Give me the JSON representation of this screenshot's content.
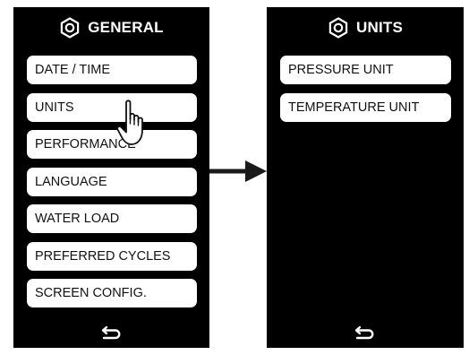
{
  "left_screen": {
    "title": "GENERAL",
    "icon": "hex-nut-settings-icon",
    "items": [
      {
        "label": "DATE / TIME"
      },
      {
        "label": "UNITS"
      },
      {
        "label": "PERFORMANCE"
      },
      {
        "label": "LANGUAGE"
      },
      {
        "label": "WATER LOAD"
      },
      {
        "label": "PREFERRED CYCLES"
      },
      {
        "label": "SCREEN CONFIG."
      }
    ],
    "back_icon": "back-arrow-icon"
  },
  "right_screen": {
    "title": "UNITS",
    "icon": "hex-nut-settings-icon",
    "items": [
      {
        "label": "PRESSURE UNIT"
      },
      {
        "label": "TEMPERATURE UNIT"
      }
    ],
    "back_icon": "back-arrow-icon"
  },
  "annotations": {
    "cursor_icon": "pointing-hand-icon",
    "transition_icon": "right-arrow-icon",
    "colors": {
      "screen_background": "#000000",
      "button_background": "#ffffff",
      "button_text": "#111111"
    }
  }
}
